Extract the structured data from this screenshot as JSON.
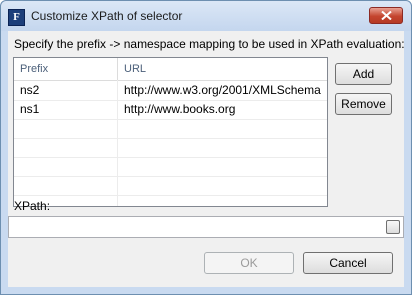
{
  "window": {
    "title": "Customize XPath of selector",
    "icon": "F"
  },
  "prompt": "Specify the prefix -> namespace mapping to be used in XPath evaluation:",
  "table": {
    "columns": [
      "Prefix",
      "URL"
    ],
    "rows": [
      {
        "prefix": "ns2",
        "url": "http://www.w3.org/2001/XMLSchema"
      },
      {
        "prefix": "ns1",
        "url": "http://www.books.org"
      }
    ]
  },
  "buttons": {
    "add": "Add",
    "remove": "Remove",
    "ok": "OK",
    "cancel": "Cancel"
  },
  "xpath": {
    "label": "XPath:",
    "value": ""
  }
}
